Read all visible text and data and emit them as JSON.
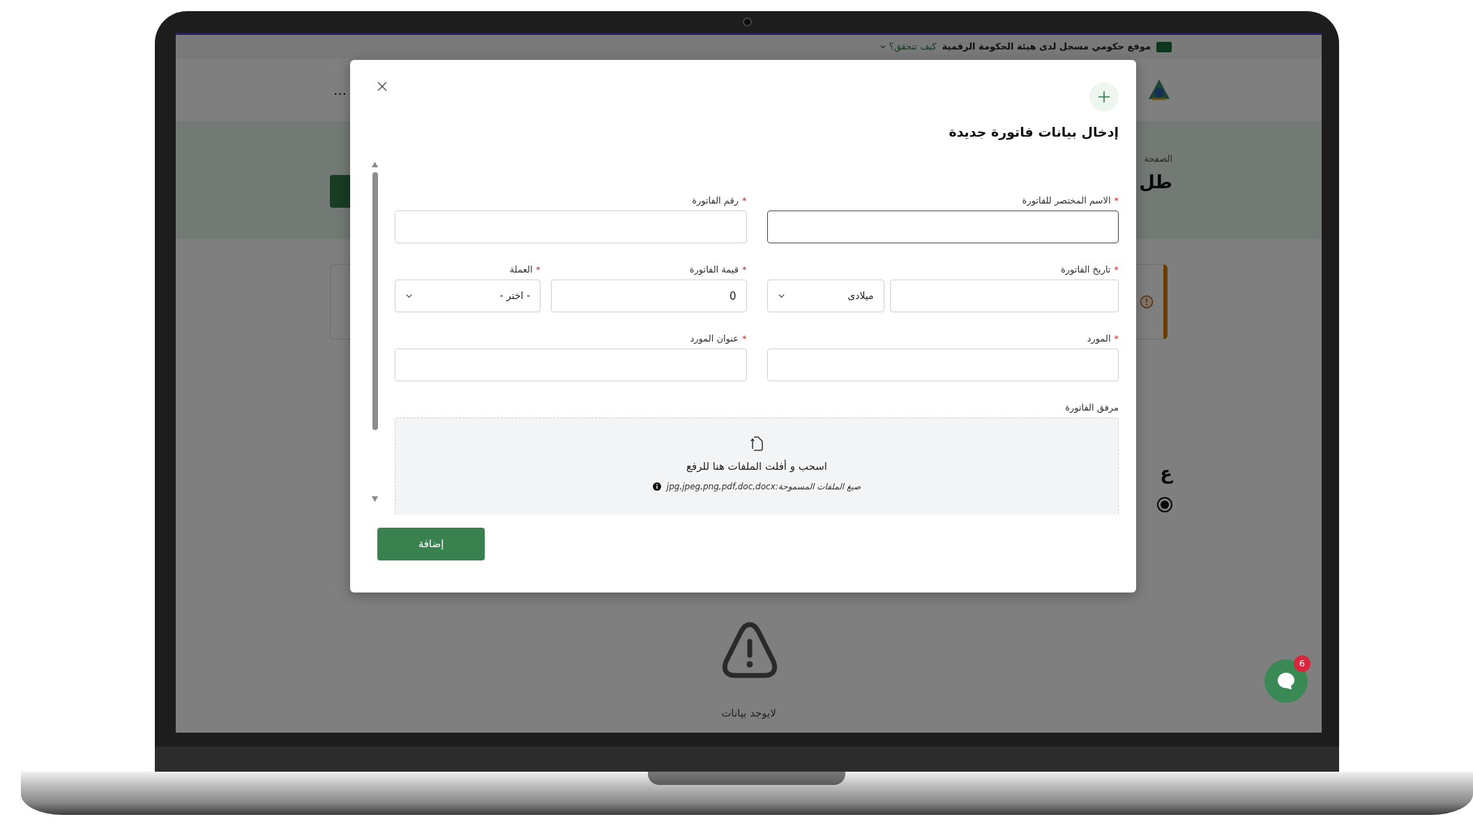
{
  "banner": {
    "text": "موقع حكومي مسجل لدى هيئة الحكومة الرقمية",
    "link": "كيف تتحقق؟"
  },
  "header": {
    "menu": "..."
  },
  "page": {
    "breadcrumb": "الصفحة",
    "heading": "طل",
    "section_heading": "ع",
    "radio": {
      "selected": true
    },
    "empty_text": "لايوجد بيانات"
  },
  "chat": {
    "badge": "6"
  },
  "modal": {
    "title": "إدخال بيانات فاتورة جديدة",
    "fields": [
      {
        "kind": "text",
        "marker": "*",
        "label": "الاسم المختصر للفاتورة",
        "focused": true
      },
      {
        "kind": "text",
        "marker": "*",
        "label": "رقم الفاتورة",
        "focused": false
      },
      {
        "kind": "date",
        "marker": "*",
        "label": "تاريخ الفاتورة",
        "calendar": "ميلادى",
        "focused": false
      },
      {
        "kind": "amount",
        "marker": "*",
        "label": "قيمة الفاتورة",
        "value": "0",
        "focused": false
      },
      {
        "kind": "select",
        "marker": "*",
        "label": "العملة",
        "value": "- اختر -"
      },
      {
        "kind": "text",
        "marker": "*",
        "label": "المورد",
        "focused": false
      },
      {
        "kind": "text",
        "marker": "*",
        "label": "عنوان المورد",
        "focused": false
      }
    ],
    "attachment": {
      "label": "مرفق الفاتورة",
      "prompt": "اسحب و أفلت الملفات هنا للرفع",
      "formats": "صيغ الملفات المسموحة:jpg,jpeg,png,pdf,doc,docx"
    },
    "submit": "إضافة"
  }
}
